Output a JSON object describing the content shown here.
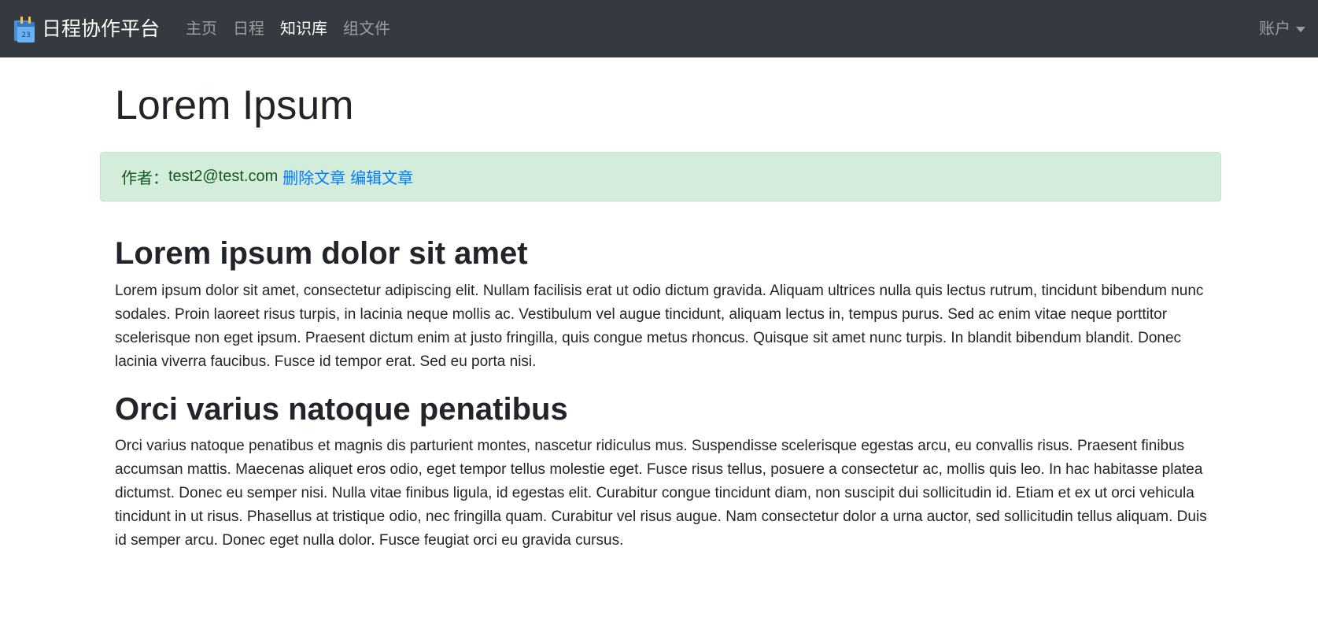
{
  "navbar": {
    "brand": "日程协作平台",
    "links": [
      "主页",
      "日程",
      "知识库",
      "组文件"
    ],
    "active_index": 2,
    "account": "账户",
    "logo_icon": "calendar-logo-icon",
    "colors": {
      "background": "#343a40",
      "active": "#ffffff",
      "inactive": "rgba(255,255,255,0.5)"
    }
  },
  "article": {
    "title": "Lorem Ipsum",
    "meta": {
      "author_label": "作者：",
      "author": "test2@test.com",
      "delete_link": "删除文章",
      "edit_link": "编辑文章",
      "colors": {
        "background": "#d4edda",
        "text": "#155724",
        "link": "#007bff"
      }
    },
    "sections": [
      {
        "heading": "Lorem ipsum dolor sit amet",
        "body": "Lorem ipsum dolor sit amet, consectetur adipiscing elit. Nullam facilisis erat ut odio dictum gravida. Aliquam ultrices nulla quis lectus rutrum, tincidunt bibendum nunc sodales. Proin laoreet risus turpis, in lacinia neque mollis ac. Vestibulum vel augue tincidunt, aliquam lectus in, tempus purus. Sed ac enim vitae neque porttitor scelerisque non eget ipsum. Praesent dictum enim at justo fringilla, quis congue metus rhoncus. Quisque sit amet nunc turpis. In blandit bibendum blandit. Donec lacinia viverra faucibus. Fusce id tempor erat. Sed eu porta nisi."
      },
      {
        "heading": "Orci varius natoque penatibus",
        "body": "Orci varius natoque penatibus et magnis dis parturient montes, nascetur ridiculus mus. Suspendisse scelerisque egestas arcu, eu convallis risus. Praesent finibus accumsan mattis. Maecenas aliquet eros odio, eget tempor tellus molestie eget. Fusce risus tellus, posuere a consectetur ac, mollis quis leo. In hac habitasse platea dictumst. Donec eu semper nisi. Nulla vitae finibus ligula, id egestas elit. Curabitur congue tincidunt diam, non suscipit dui sollicitudin id. Etiam et ex ut orci vehicula tincidunt in ut risus. Phasellus at tristique odio, nec fringilla quam. Curabitur vel risus augue. Nam consectetur dolor a urna auctor, sed sollicitudin tellus aliquam. Duis id semper arcu. Donec eget nulla dolor. Fusce feugiat orci eu gravida cursus."
      }
    ]
  }
}
